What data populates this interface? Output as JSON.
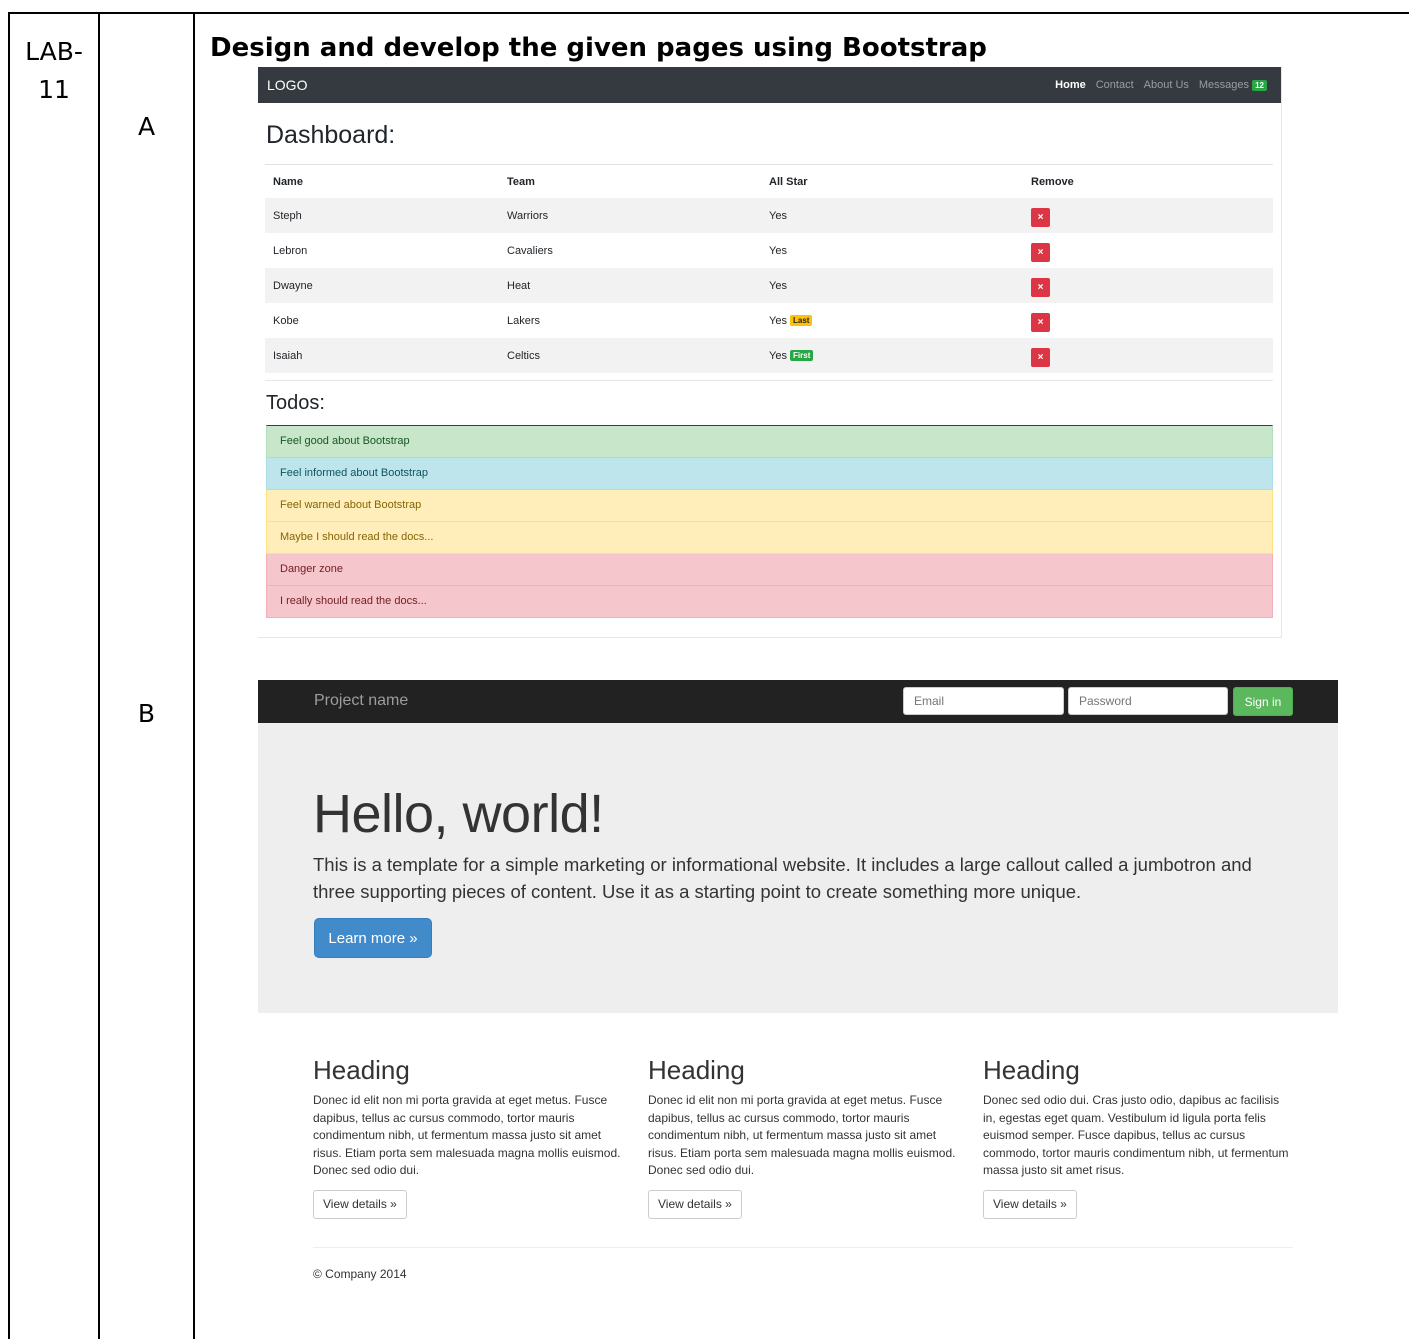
{
  "doc": {
    "lab": "LAB-11",
    "part_a": "A",
    "part_b": "B",
    "task_title": "Design and develop the given pages using Bootstrap"
  },
  "shot_a": {
    "brand": "LOGO",
    "nav": [
      "Home",
      "Contact",
      "About Us",
      "Messages"
    ],
    "messages_count": "12",
    "dashboard_title": "Dashboard:",
    "table": {
      "headers": [
        "Name",
        "Team",
        "All Star",
        "Remove"
      ],
      "rows": [
        {
          "name": "Steph",
          "team": "Warriors",
          "all_star": "Yes",
          "tag": ""
        },
        {
          "name": "Lebron",
          "team": "Cavaliers",
          "all_star": "Yes",
          "tag": ""
        },
        {
          "name": "Dwayne",
          "team": "Heat",
          "all_star": "Yes",
          "tag": ""
        },
        {
          "name": "Kobe",
          "team": "Lakers",
          "all_star": "Yes",
          "tag": "Last"
        },
        {
          "name": "Isaiah",
          "team": "Celtics",
          "all_star": "Yes",
          "tag": "First"
        }
      ],
      "remove_glyph": "×"
    },
    "todos_title": "Todos:",
    "todos": [
      {
        "text": "Feel good about Bootstrap",
        "kind": "success"
      },
      {
        "text": "Feel informed about Bootstrap",
        "kind": "info"
      },
      {
        "text": "Feel warned about Bootstrap",
        "kind": "warning"
      },
      {
        "text": "Maybe I should read the docs...",
        "kind": "warning"
      },
      {
        "text": "Danger zone",
        "kind": "danger"
      },
      {
        "text": "I really should read the docs...",
        "kind": "danger"
      }
    ]
  },
  "shot_b": {
    "brand": "Project name",
    "email_placeholder": "Email",
    "password_placeholder": "Password",
    "signin_label": "Sign in",
    "hero_title": "Hello, world!",
    "hero_text": "This is a template for a simple marketing or informational website. It includes a large callout called a jumbotron and three supporting pieces of content. Use it as a starting point to create something more unique.",
    "learn_more_label": "Learn more »",
    "columns": [
      {
        "heading": "Heading",
        "text": "Donec id elit non mi porta gravida at eget metus. Fusce dapibus, tellus ac cursus commodo, tortor mauris condimentum nibh, ut fermentum massa justo sit amet risus. Etiam porta sem malesuada magna mollis euismod. Donec sed odio dui.",
        "button": "View details »"
      },
      {
        "heading": "Heading",
        "text": "Donec id elit non mi porta gravida at eget metus. Fusce dapibus, tellus ac cursus commodo, tortor mauris condimentum nibh, ut fermentum massa justo sit amet risus. Etiam porta sem malesuada magna mollis euismod. Donec sed odio dui.",
        "button": "View details »"
      },
      {
        "heading": "Heading",
        "text": "Donec sed odio dui. Cras justo odio, dapibus ac facilisis in, egestas eget quam. Vestibulum id ligula porta felis euismod semper. Fusce dapibus, tellus ac cursus commodo, tortor mauris condimentum nibh, ut fermentum massa justo sit amet risus.",
        "button": "View details »"
      }
    ],
    "footer": "© Company 2014"
  }
}
